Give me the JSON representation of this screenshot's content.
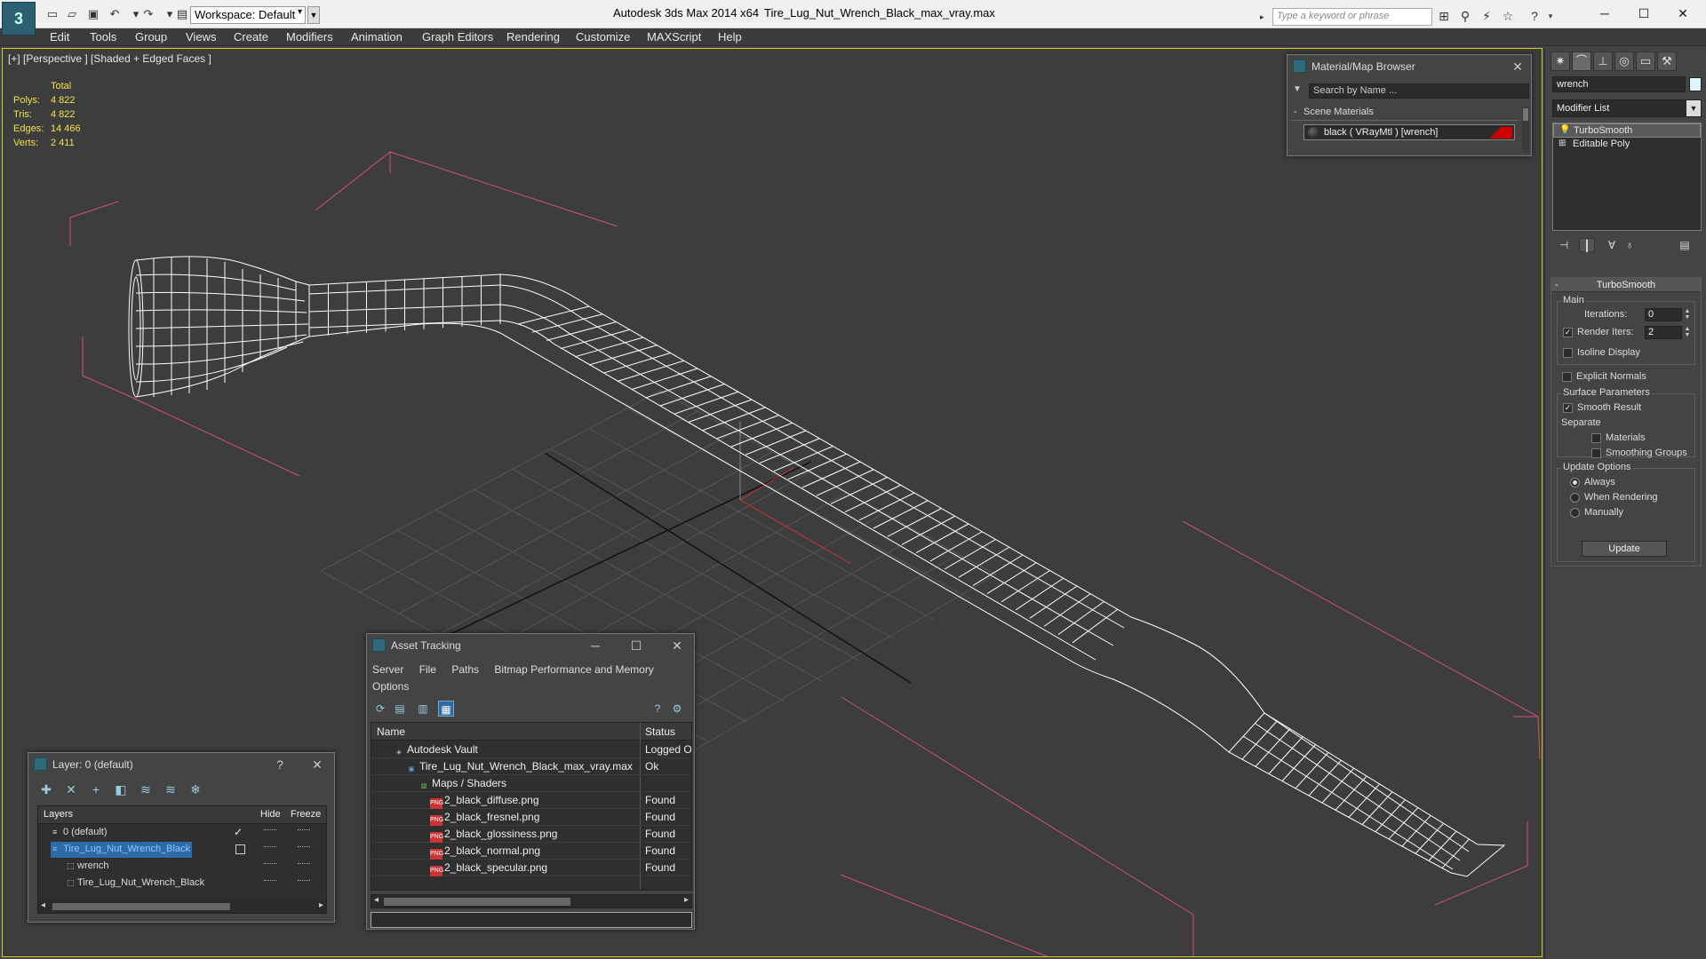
{
  "title_bar": {
    "app_title": "Autodesk 3ds Max  2014 x64",
    "file_title": "Tire_Lug_Nut_Wrench_Black_max_vray.max",
    "workspace": "Workspace: Default",
    "search_placeholder": "Type a keyword or phrase",
    "logo": "app-logo"
  },
  "menu": [
    "Edit",
    "Tools",
    "Group",
    "Views",
    "Create",
    "Modifiers",
    "Animation",
    "Graph Editors",
    "Rendering",
    "Customize",
    "MAXScript",
    "Help"
  ],
  "viewport": {
    "label": "[+] [Perspective ] [Shaded + Edged Faces ]",
    "stats": {
      "header": "Total",
      "rows": [
        {
          "key": "Polys:",
          "value": "4 822"
        },
        {
          "key": "Tris:",
          "value": "4 822"
        },
        {
          "key": "Edges:",
          "value": "14 466"
        },
        {
          "key": "Verts:",
          "value": "2 411"
        }
      ]
    },
    "colors": {
      "bbox": "#d0507a",
      "wire": "#ffffff",
      "grid": "#555555",
      "stats": "#f2e24a"
    }
  },
  "command_panel": {
    "object_name": "wrench",
    "modifier_list": "Modifier List",
    "stack": [
      "TurboSmooth",
      "Editable Poly"
    ],
    "rollout_title": "TurboSmooth",
    "main_group": "Main",
    "iterations_label": "Iterations:",
    "iterations_value": "0",
    "render_iters_label": "Render Iters:",
    "render_iters_value": "2",
    "isoline_display": "Isoline Display",
    "explicit_normals": "Explicit Normals",
    "surface_group": "Surface Parameters",
    "smooth_result": "Smooth Result",
    "separate_label": "Separate",
    "materials": "Materials",
    "smoothing_groups": "Smoothing Groups",
    "update_group": "Update Options",
    "always": "Always",
    "when_rendering": "When Rendering",
    "manually": "Manually",
    "update_button": "Update"
  },
  "material_browser": {
    "title": "Material/Map Browser",
    "search_placeholder": "Search by Name ...",
    "section": "Scene Materials",
    "item": "black  ( VRayMtl )  [wrench]"
  },
  "asset_tracking": {
    "title": "Asset Tracking",
    "menu": [
      "Server",
      "File",
      "Paths",
      "Bitmap Performance and Memory"
    ],
    "menu2": "Options",
    "columns": {
      "name": "Name",
      "status": "Status"
    },
    "rows": [
      {
        "name": "Autodesk Vault",
        "status": "Logged Out",
        "indent": 0,
        "icon": "vault-icon"
      },
      {
        "name": "Tire_Lug_Nut_Wrench_Black_max_vray.max",
        "status": "Ok",
        "indent": 1,
        "icon": "max-file-icon"
      },
      {
        "name": "Maps / Shaders",
        "status": "",
        "indent": 2,
        "icon": "maps-icon"
      },
      {
        "name": "2_black_diffuse.png",
        "status": "Found",
        "indent": 3,
        "icon": "png-icon"
      },
      {
        "name": "2_black_fresnel.png",
        "status": "Found",
        "indent": 3,
        "icon": "png-icon"
      },
      {
        "name": "2_black_glossiness.png",
        "status": "Found",
        "indent": 3,
        "icon": "png-icon"
      },
      {
        "name": "2_black_normal.png",
        "status": "Found",
        "indent": 3,
        "icon": "png-icon"
      },
      {
        "name": "2_black_specular.png",
        "status": "Found",
        "indent": 3,
        "icon": "png-icon"
      }
    ]
  },
  "layers": {
    "title": "Layer: 0 (default)",
    "help": "?",
    "columns": {
      "layers": "Layers",
      "hide": "Hide",
      "freeze": "Freeze"
    },
    "rows": [
      {
        "name": "0 (default)",
        "indent": 1,
        "current": true,
        "selected": false
      },
      {
        "name": "Tire_Lug_Nut_Wrench_Black",
        "indent": 1,
        "current": false,
        "selected": true
      },
      {
        "name": "wrench",
        "indent": 2,
        "current": false,
        "selected": false
      },
      {
        "name": "Tire_Lug_Nut_Wrench_Black",
        "indent": 2,
        "current": false,
        "selected": false
      }
    ]
  }
}
